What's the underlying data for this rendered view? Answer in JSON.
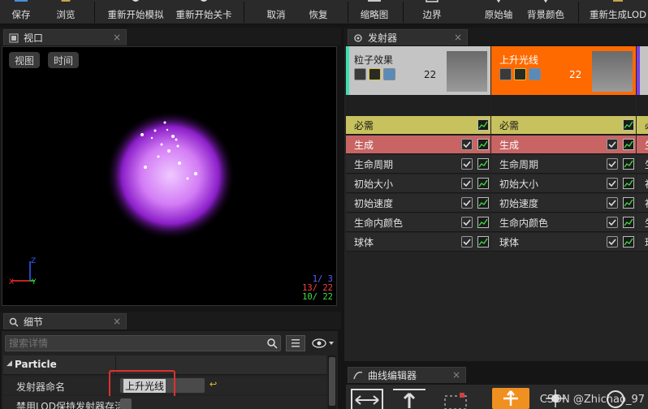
{
  "toolbar": {
    "buttons": [
      {
        "label": "保存"
      },
      {
        "label": "浏览"
      },
      {
        "label": "重新开始模拟"
      },
      {
        "label": "重新开始关卡"
      },
      {
        "label": "取消"
      },
      {
        "label": "恢复"
      },
      {
        "label": "缩略图"
      },
      {
        "label": "边界"
      },
      {
        "label": "原始轴"
      },
      {
        "label": "背景颜色"
      },
      {
        "label": "重新生成LOD"
      }
    ]
  },
  "viewport_panel": {
    "tab_label": "视口",
    "view_button": "视图",
    "time_button": "时间",
    "stats": [
      {
        "text": "1/  3",
        "color": "#6060ff"
      },
      {
        "text": "13/ 22",
        "color": "#ff4040"
      },
      {
        "text": "10/ 22",
        "color": "#40e040"
      }
    ],
    "axis_labels": {
      "x": "X",
      "y": "Y",
      "z": "Z"
    }
  },
  "details_panel": {
    "tab_label": "细节",
    "search_placeholder": "搜索详情",
    "category": "Particle",
    "props": [
      {
        "label": "发射器命名",
        "value": "上升光线"
      },
      {
        "label": "禁用LOD保持发射器存活"
      }
    ]
  },
  "emitters_panel": {
    "tab_label": "发射器",
    "emitters": [
      {
        "name": "粒子效果",
        "count": "22",
        "header_color": "#c4c4c4",
        "accent": "#3fe0b0",
        "active": false
      },
      {
        "name": "上升光线",
        "count": "22",
        "header_color": "#ff6a00",
        "accent": "#ff6a00",
        "active": true
      },
      {
        "name": "",
        "count": "",
        "header_color": "#c4c4c4",
        "accent": "#7a3fe0",
        "active": false
      }
    ],
    "modules": [
      {
        "label": "必需",
        "color": "#c8c25e",
        "text_color": "#1a1a1a"
      },
      {
        "label": "生成",
        "color": "#c86464",
        "text_color": "#ffffff"
      },
      {
        "label": "生命周期",
        "color": "#2a2a2a",
        "text_color": "#e0e0e0"
      },
      {
        "label": "初始大小",
        "color": "#2a2a2a",
        "text_color": "#e0e0e0"
      },
      {
        "label": "初始速度",
        "color": "#2a2a2a",
        "text_color": "#e0e0e0"
      },
      {
        "label": "生命内颜色",
        "color": "#2a2a2a",
        "text_color": "#e0e0e0"
      },
      {
        "label": "球体",
        "color": "#2a2a2a",
        "text_color": "#e0e0e0"
      }
    ]
  },
  "curve_editor": {
    "tab_label": "曲线编辑器"
  },
  "watermark": "CSDN @Zhichao_97"
}
